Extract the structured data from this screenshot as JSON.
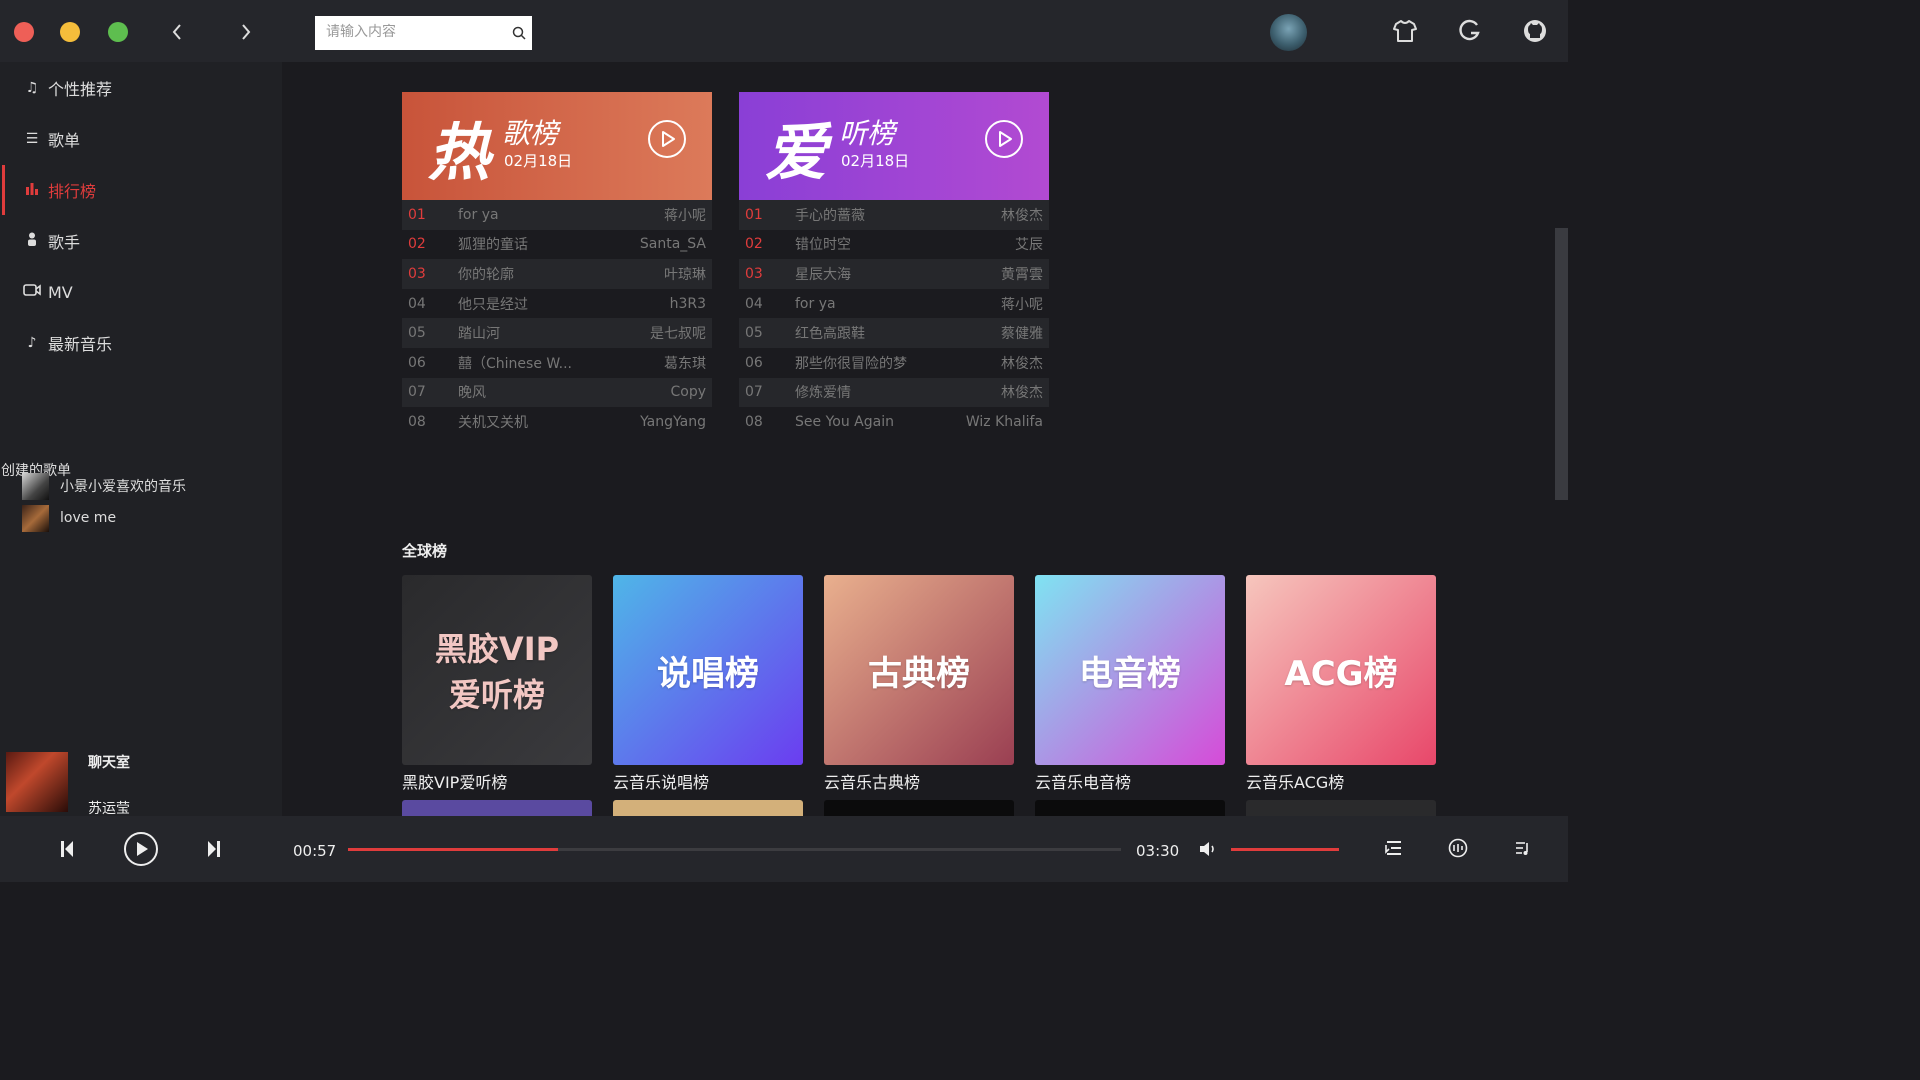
{
  "window": {
    "dot_colors": [
      "#ee5f57",
      "#f5bd3b",
      "#5ebe4f"
    ]
  },
  "search": {
    "placeholder": "请输入内容"
  },
  "sidebar": {
    "items": [
      {
        "label": "个性推荐",
        "icon": "music-note-icon"
      },
      {
        "label": "歌单",
        "icon": "playlist-icon"
      },
      {
        "label": "排行榜",
        "icon": "chart-bar-icon",
        "active": true
      },
      {
        "label": "歌手",
        "icon": "person-icon"
      },
      {
        "label": "MV",
        "icon": "video-icon"
      },
      {
        "label": "最新音乐",
        "icon": "new-music-icon"
      }
    ],
    "created_title": "创建的歌单",
    "playlists": [
      {
        "name": "小景小爱喜欢的音乐"
      },
      {
        "name": "love me"
      }
    ]
  },
  "now_playing": {
    "title": "聊天室",
    "artist": "苏运莹"
  },
  "charts": [
    {
      "big": "热",
      "sub": "歌榜",
      "date": "02月18日",
      "color_from": "#c8543a",
      "color_to": "#dc7a5a",
      "songs": [
        {
          "rank": "01",
          "name": "for ya",
          "artist": "蒋小呢"
        },
        {
          "rank": "02",
          "name": "狐狸的童话",
          "artist": "Santa_SA"
        },
        {
          "rank": "03",
          "name": "你的轮廓",
          "artist": "叶琼琳"
        },
        {
          "rank": "04",
          "name": "他只是经过",
          "artist": "h3R3"
        },
        {
          "rank": "05",
          "name": "踏山河",
          "artist": "是七叔呢"
        },
        {
          "rank": "06",
          "name": "囍（Chinese W...",
          "artist": "葛东琪"
        },
        {
          "rank": "07",
          "name": "晚风",
          "artist": "Copy"
        },
        {
          "rank": "08",
          "name": "关机又关机",
          "artist": "YangYang"
        }
      ]
    },
    {
      "big": "爱",
      "sub": "听榜",
      "date": "02月18日",
      "color_from": "#8a3fd6",
      "color_to": "#b24ad2",
      "songs": [
        {
          "rank": "01",
          "name": "手心的蔷薇",
          "artist": "林俊杰"
        },
        {
          "rank": "02",
          "name": "错位时空",
          "artist": "艾辰"
        },
        {
          "rank": "03",
          "name": "星辰大海",
          "artist": "黄霄雲"
        },
        {
          "rank": "04",
          "name": "for ya",
          "artist": "蒋小呢"
        },
        {
          "rank": "05",
          "name": "红色高跟鞋",
          "artist": "蔡健雅"
        },
        {
          "rank": "06",
          "name": "那些你很冒险的梦",
          "artist": "林俊杰"
        },
        {
          "rank": "07",
          "name": "修炼爱情",
          "artist": "林俊杰"
        },
        {
          "rank": "08",
          "name": "See You Again",
          "artist": "Wiz Khalifa"
        }
      ]
    }
  ],
  "global": {
    "title": "全球榜",
    "tiles": [
      {
        "text": "黑胶VIP\n爱听榜",
        "label": "黑胶VIP爱听榜",
        "bg": "linear-gradient(135deg,#2a2a2c,#3a3a3d)"
      },
      {
        "text": "说唱榜",
        "label": "云音乐说唱榜",
        "bg": "linear-gradient(135deg,#4fb6e8,#6b3df0)"
      },
      {
        "text": "古典榜",
        "label": "云音乐古典榜",
        "bg": "linear-gradient(135deg,#e9b08e,#9a3f52)"
      },
      {
        "text": "电音榜",
        "label": "云音乐电音榜",
        "bg": "linear-gradient(135deg,#7fe3f2,#d64bd8)"
      },
      {
        "text": "ACG榜",
        "label": "云音乐ACG榜",
        "bg": "linear-gradient(135deg,#f6c6bd,#e8476a)"
      }
    ],
    "row2_colors": [
      "#5a4aa0",
      "#d3b07a",
      "#0b0b0c",
      "#0b0b0c",
      "#2a2a2c"
    ]
  },
  "player": {
    "current_time": "00:57",
    "total_time": "03:30",
    "progress": 0.272,
    "volume": 1.0
  }
}
